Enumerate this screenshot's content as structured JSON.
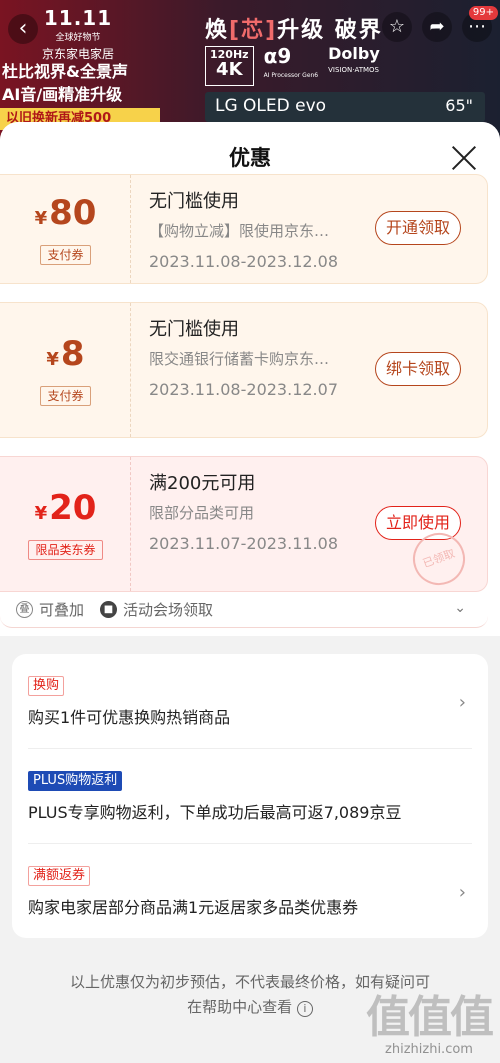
{
  "banner": {
    "logo_big": "11.11",
    "logo_small": "全球好物节",
    "store": "京东家电家居",
    "left_line1": "杜比视界&全景声",
    "left_line2": "AI音/画精准升级",
    "promo_strip": "以旧换新再减500",
    "headline_pre": "焕",
    "headline_core": "[芯]",
    "headline_post": "升级 破界",
    "badge_hz": "120Hz",
    "badge_4k": "4K",
    "badge_alpha": "α9",
    "badge_alpha_sub": "AI Processor Gen6",
    "dolby": "Dolby",
    "dolby_sub": "VISION·ATMOS",
    "oled": "LG OLED evo",
    "inch": "65\"",
    "cart_count": "99+"
  },
  "sheet": {
    "title": "优惠"
  },
  "coupons": [
    {
      "yen": "¥",
      "amount": "80",
      "tag": "支付券",
      "title": "无门槛使用",
      "desc": "【购物立减】限使用京东…",
      "date": "2023.11.08-2023.12.08",
      "button": "开通领取"
    },
    {
      "yen": "¥",
      "amount": "8",
      "tag": "支付券",
      "title": "无门槛使用",
      "desc": "限交通银行储蓄卡购京东…",
      "date": "2023.11.08-2023.12.07",
      "button": "绑卡领取"
    },
    {
      "yen": "¥",
      "amount": "20",
      "tag": "限品类东券",
      "title": "满200元可用",
      "desc": "限部分品类可用",
      "date": "2023.11.07-2023.11.08",
      "button": "立即使用",
      "stamp": "已领取"
    }
  ],
  "hints": {
    "stackable": "可叠加",
    "venue": "活动会场领取"
  },
  "promos": [
    {
      "tag": "换购",
      "text": "购买1件可优惠换购热销商品"
    },
    {
      "tag": "PLUS购物返利",
      "text": "PLUS专享购物返利，下单成功后最高可返7,089京豆"
    },
    {
      "tag": "满额返券",
      "text": "购家电家居部分商品满1元返居家多品类优惠券"
    }
  ],
  "footer": {
    "line1": "以上优惠仅为初步预估，不代表最终价格，如有疑问可",
    "line2": "在帮助中心查看"
  },
  "watermark": {
    "big": "值值值",
    "small": "zhizhizhi.com"
  }
}
